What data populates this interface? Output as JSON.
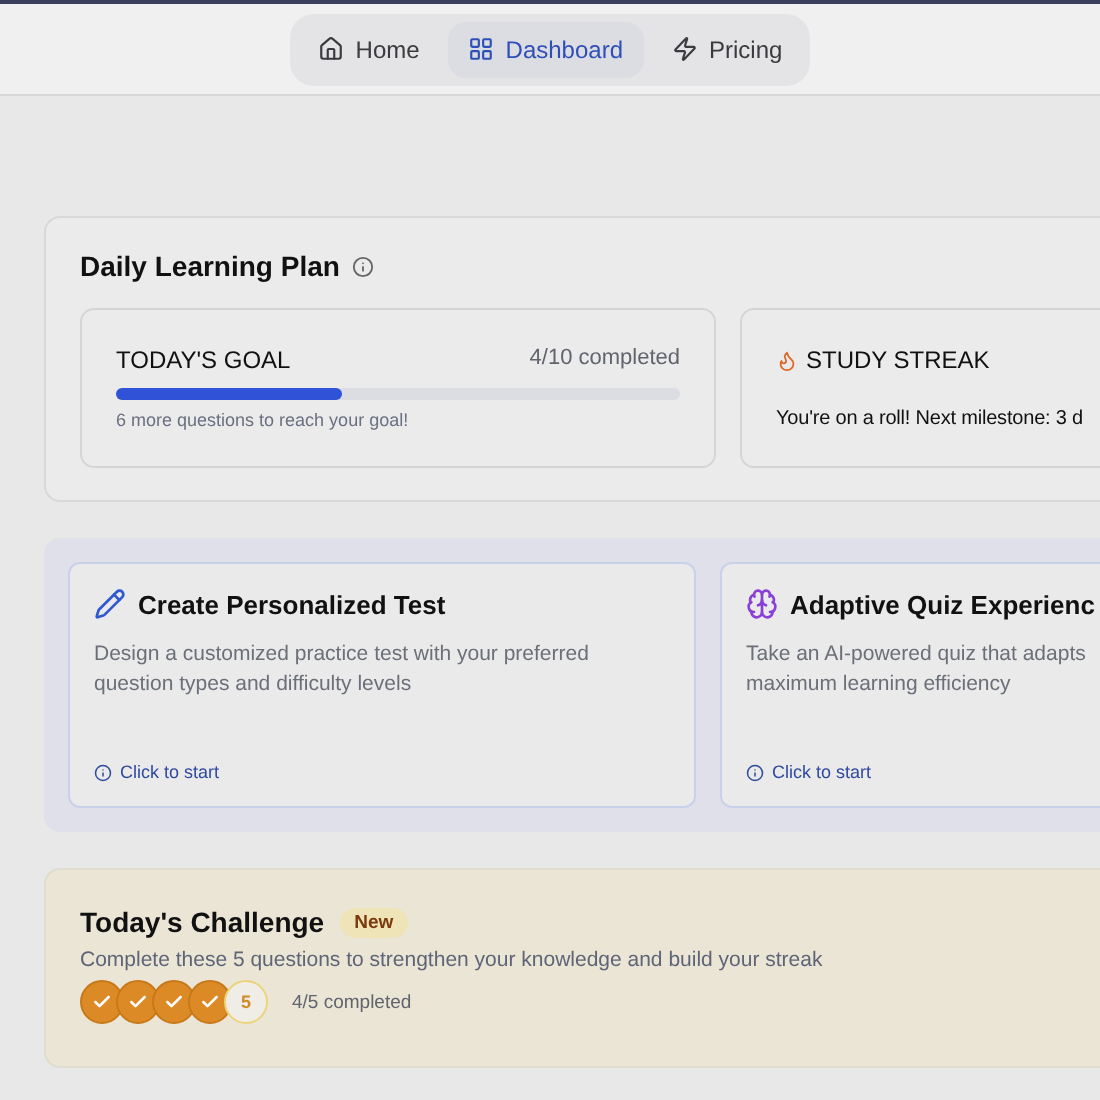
{
  "nav": [
    {
      "label": "Home",
      "kind": "home",
      "selected": false
    },
    {
      "label": "Dashboard",
      "kind": "grid",
      "selected": true
    },
    {
      "label": "Pricing",
      "kind": "bolt",
      "selected": false
    }
  ],
  "plan": {
    "title": "Daily Learning Plan",
    "goal": {
      "title": "TODAY'S GOAL",
      "count": "4/10 completed",
      "level": 0.4,
      "hint": "6 more questions to reach your goal!"
    },
    "streak": {
      "title": "STUDY STREAK",
      "text": "You're on a roll! Next milestone: 3 d"
    }
  },
  "actions": [
    {
      "kind": "pencil",
      "title": "Create Personalized Test",
      "text": "Design a customized practice test with your preferred question types and difficulty levels",
      "cta": "Click to start"
    },
    {
      "kind": "brain",
      "title": "Adaptive Quiz Experienc",
      "text": "Take an AI-powered quiz that adapts\nmaximum learning efficiency",
      "cta": "Click to start"
    }
  ],
  "challenge": {
    "title": "Today's Challenge",
    "badge": "New",
    "text": "Complete these 5 questions to strengthen your knowledge and build your streak",
    "steps": [
      {
        "done": true
      },
      {
        "done": true
      },
      {
        "done": true
      },
      {
        "done": true
      },
      {
        "done": false,
        "label": "5"
      }
    ],
    "count": "4/5 completed"
  }
}
